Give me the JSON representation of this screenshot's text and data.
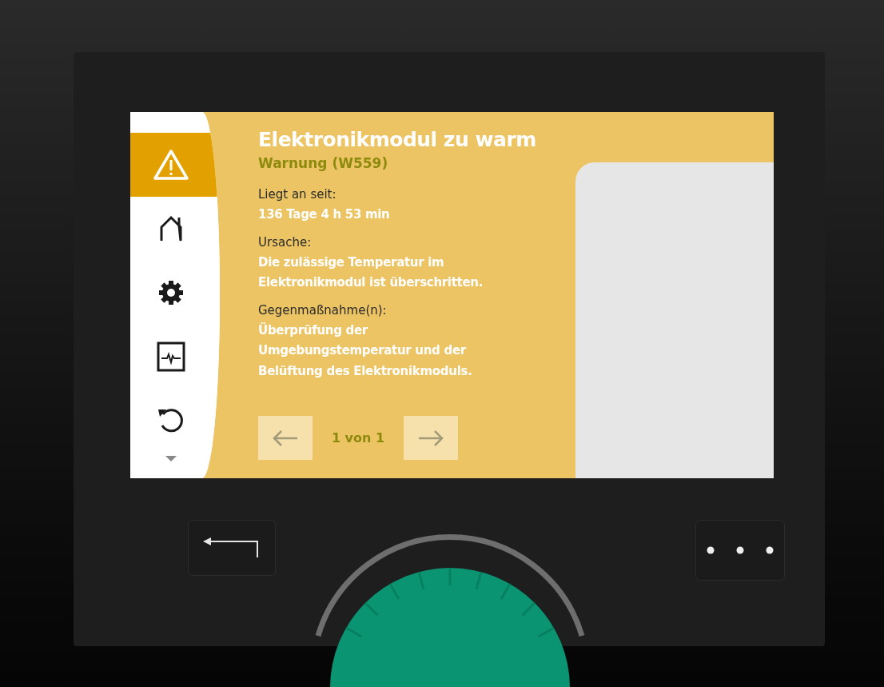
{
  "sidebar": {
    "items": [
      {
        "kind": "warning",
        "selected": true
      },
      {
        "kind": "home",
        "selected": false
      },
      {
        "kind": "settings",
        "selected": false
      },
      {
        "kind": "monitor",
        "selected": false
      },
      {
        "kind": "undo",
        "selected": false
      }
    ]
  },
  "title": "Elektronikmodul zu warm",
  "subtitle": "Warnung (W559)",
  "sections": [
    {
      "label": "Liegt an seit:",
      "value": [
        "136 Tage 4 h 53 min"
      ]
    },
    {
      "label": "Ursache:",
      "value": [
        "Die zulässige Temperatur im",
        "Elektronikmodul ist überschritten."
      ]
    },
    {
      "label": "Gegenmaßnahme(n):",
      "value": [
        "Überprüfung der",
        "Umgebungstemperatur und der",
        "Belüftung des Elektronikmoduls."
      ]
    }
  ],
  "pager": {
    "text": "1 von 1"
  }
}
